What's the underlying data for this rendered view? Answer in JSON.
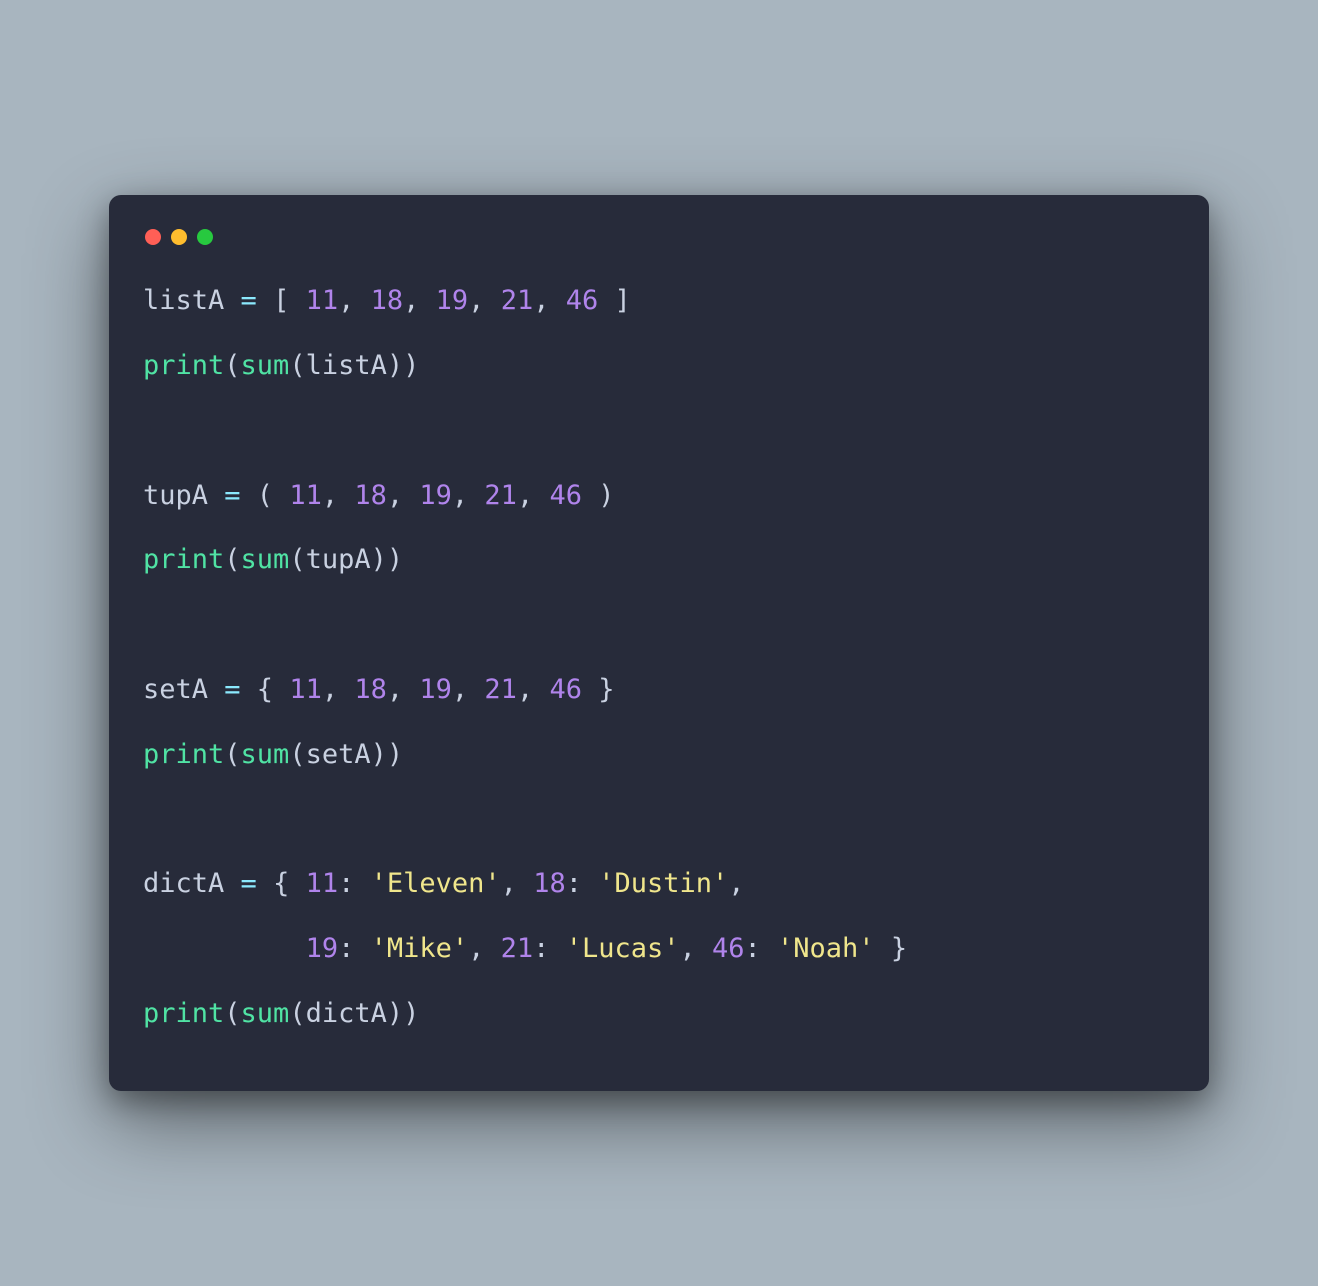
{
  "window": {
    "controls": [
      "close",
      "minimize",
      "zoom"
    ]
  },
  "code": {
    "colors": {
      "bg": "#272b3a",
      "default": "#c9d1e1",
      "operator": "#8be9fd",
      "number": "#b084eb",
      "function": "#50e3a4",
      "string": "#f0e68c"
    },
    "tokens": [
      [
        {
          "t": "listA ",
          "c": "default"
        },
        {
          "t": "=",
          "c": "op"
        },
        {
          "t": " [ ",
          "c": "default"
        },
        {
          "t": "11",
          "c": "num"
        },
        {
          "t": ", ",
          "c": "default"
        },
        {
          "t": "18",
          "c": "num"
        },
        {
          "t": ", ",
          "c": "default"
        },
        {
          "t": "19",
          "c": "num"
        },
        {
          "t": ", ",
          "c": "default"
        },
        {
          "t": "21",
          "c": "num"
        },
        {
          "t": ", ",
          "c": "default"
        },
        {
          "t": "46",
          "c": "num"
        },
        {
          "t": " ]",
          "c": "default"
        }
      ],
      [
        {
          "t": "print",
          "c": "func"
        },
        {
          "t": "(",
          "c": "default"
        },
        {
          "t": "sum",
          "c": "func"
        },
        {
          "t": "(listA))",
          "c": "default"
        }
      ],
      [],
      [
        {
          "t": "tupA ",
          "c": "default"
        },
        {
          "t": "=",
          "c": "op"
        },
        {
          "t": " ( ",
          "c": "default"
        },
        {
          "t": "11",
          "c": "num"
        },
        {
          "t": ", ",
          "c": "default"
        },
        {
          "t": "18",
          "c": "num"
        },
        {
          "t": ", ",
          "c": "default"
        },
        {
          "t": "19",
          "c": "num"
        },
        {
          "t": ", ",
          "c": "default"
        },
        {
          "t": "21",
          "c": "num"
        },
        {
          "t": ", ",
          "c": "default"
        },
        {
          "t": "46",
          "c": "num"
        },
        {
          "t": " )",
          "c": "default"
        }
      ],
      [
        {
          "t": "print",
          "c": "func"
        },
        {
          "t": "(",
          "c": "default"
        },
        {
          "t": "sum",
          "c": "func"
        },
        {
          "t": "(tupA))",
          "c": "default"
        }
      ],
      [],
      [
        {
          "t": "setA ",
          "c": "default"
        },
        {
          "t": "=",
          "c": "op"
        },
        {
          "t": " { ",
          "c": "default"
        },
        {
          "t": "11",
          "c": "num"
        },
        {
          "t": ", ",
          "c": "default"
        },
        {
          "t": "18",
          "c": "num"
        },
        {
          "t": ", ",
          "c": "default"
        },
        {
          "t": "19",
          "c": "num"
        },
        {
          "t": ", ",
          "c": "default"
        },
        {
          "t": "21",
          "c": "num"
        },
        {
          "t": ", ",
          "c": "default"
        },
        {
          "t": "46",
          "c": "num"
        },
        {
          "t": " }",
          "c": "default"
        }
      ],
      [
        {
          "t": "print",
          "c": "func"
        },
        {
          "t": "(",
          "c": "default"
        },
        {
          "t": "sum",
          "c": "func"
        },
        {
          "t": "(setA))",
          "c": "default"
        }
      ],
      [],
      [
        {
          "t": "dictA ",
          "c": "default"
        },
        {
          "t": "=",
          "c": "op"
        },
        {
          "t": " { ",
          "c": "default"
        },
        {
          "t": "11",
          "c": "num"
        },
        {
          "t": ": ",
          "c": "default"
        },
        {
          "t": "'Eleven'",
          "c": "str"
        },
        {
          "t": ", ",
          "c": "default"
        },
        {
          "t": "18",
          "c": "num"
        },
        {
          "t": ": ",
          "c": "default"
        },
        {
          "t": "'Dustin'",
          "c": "str"
        },
        {
          "t": ", ",
          "c": "default"
        }
      ],
      [
        {
          "t": "          ",
          "c": "default"
        },
        {
          "t": "19",
          "c": "num"
        },
        {
          "t": ": ",
          "c": "default"
        },
        {
          "t": "'Mike'",
          "c": "str"
        },
        {
          "t": ", ",
          "c": "default"
        },
        {
          "t": "21",
          "c": "num"
        },
        {
          "t": ": ",
          "c": "default"
        },
        {
          "t": "'Lucas'",
          "c": "str"
        },
        {
          "t": ", ",
          "c": "default"
        },
        {
          "t": "46",
          "c": "num"
        },
        {
          "t": ": ",
          "c": "default"
        },
        {
          "t": "'Noah'",
          "c": "str"
        },
        {
          "t": " }",
          "c": "default"
        }
      ],
      [
        {
          "t": "print",
          "c": "func"
        },
        {
          "t": "(",
          "c": "default"
        },
        {
          "t": "sum",
          "c": "func"
        },
        {
          "t": "(dictA))",
          "c": "default"
        }
      ]
    ]
  }
}
